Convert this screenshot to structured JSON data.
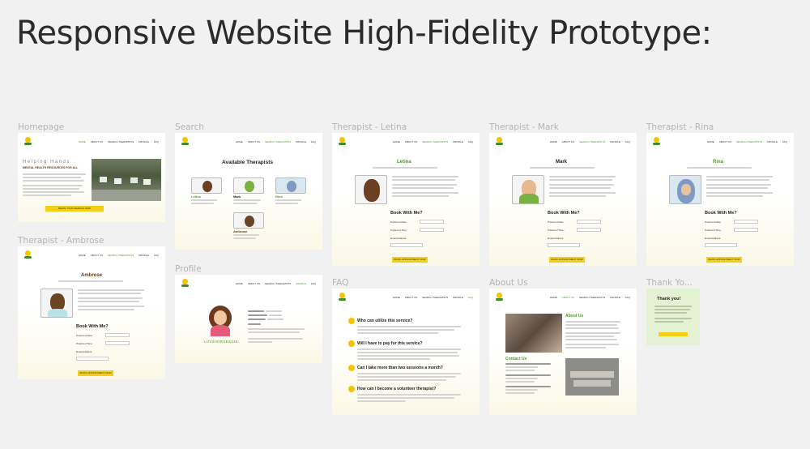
{
  "page_title": "Responsive Website High-Fidelity Prototype:",
  "frames": {
    "homepage": {
      "label": "Homepage",
      "hero_title": "Helping Hands",
      "hero_subtitle": "MENTAL HEALTH RESOURCES FOR ALL",
      "cta": "BEGIN YOUR SEARCH NOW"
    },
    "search": {
      "label": "Search",
      "heading": "Available Therapists",
      "therapists": [
        "Letina",
        "Mark",
        "Rina",
        "Ambrose"
      ]
    },
    "letina": {
      "label": "Therapist - Letina",
      "name": "Letina",
      "book": "Book With Me?"
    },
    "mark": {
      "label": "Therapist - Mark",
      "name": "Mark",
      "book": "Book With Me?"
    },
    "rina": {
      "label": "Therapist - Rina",
      "name": "Rina",
      "book": "Book With Me?"
    },
    "ambrose": {
      "label": "Therapist - Ambrose",
      "name": "Ambrose",
      "book": "Book With Me?"
    },
    "profile": {
      "label": "Profile",
      "username": "LUV4HORSES145"
    },
    "faq": {
      "label": "FAQ",
      "questions": [
        "Who can utilize this service?",
        "Will I have to pay for this service?",
        "Can I take more than two sessions a month?",
        "How can I become a volunteer therapist?"
      ]
    },
    "about": {
      "label": "About Us",
      "about_heading": "About Us",
      "contact_heading": "Contact Us"
    },
    "thanks": {
      "label": "Thank Yo...",
      "heading": "Thank you!"
    }
  },
  "nav_links": [
    "HOME",
    "ABOUT US",
    "SEARCH THERAPISTS",
    "PROFILE",
    "FAQ"
  ],
  "form_labels": [
    "Preferred Date:",
    "Preferred Time:",
    "Email Address:"
  ],
  "book_button": "BOOK APPOINTMENT NOW",
  "colors": {
    "accent_yellow": "#f5cf16",
    "green": "#4f9a2c",
    "bg": "#f1f1f2"
  }
}
